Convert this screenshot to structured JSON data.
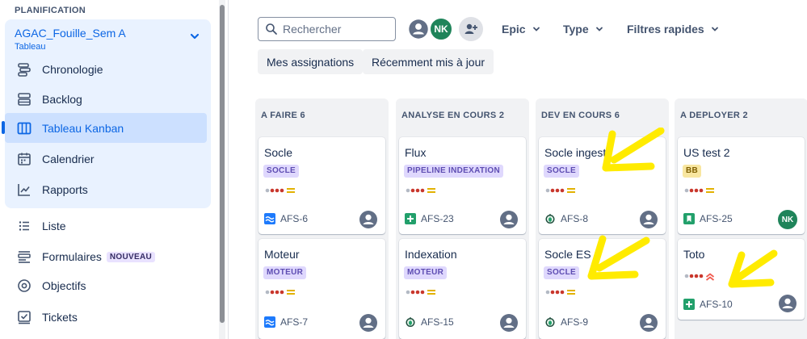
{
  "sidebar": {
    "section_title": "PLANIFICATION",
    "project": {
      "name": "AGAC_Fouille_Sem A",
      "subtitle": "Tableau"
    },
    "items": [
      {
        "label": "Chronologie",
        "icon": "timeline-icon"
      },
      {
        "label": "Backlog",
        "icon": "backlog-icon"
      },
      {
        "label": "Tableau Kanban",
        "icon": "board-icon",
        "active": true
      },
      {
        "label": "Calendrier",
        "icon": "calendar-icon"
      },
      {
        "label": "Rapports",
        "icon": "reports-icon"
      }
    ],
    "extra_items": [
      {
        "label": "Liste",
        "icon": "list-icon"
      },
      {
        "label": "Formulaires",
        "icon": "forms-icon",
        "badge": "NOUVEAU"
      },
      {
        "label": "Objectifs",
        "icon": "goals-icon"
      },
      {
        "label": "Tickets",
        "icon": "tickets-icon"
      }
    ]
  },
  "toolbar": {
    "search_placeholder": "Rechercher",
    "avatar_initials": "NK",
    "filters": [
      "Epic",
      "Type",
      "Filtres rapides"
    ],
    "quick_buttons": [
      "Mes assignations",
      "Récemment mis à jour"
    ]
  },
  "columns": [
    {
      "title": "A FAIRE 6",
      "cards": [
        {
          "title": "Socle",
          "tag": "SOCLE",
          "priority": "medium",
          "key": "AFS-6",
          "key_icon": "epic-wave-icon",
          "assignee": "unassigned"
        },
        {
          "title": "Moteur",
          "tag": "MOTEUR",
          "priority": "medium",
          "key": "AFS-7",
          "key_icon": "epic-wave-icon",
          "assignee": "unassigned"
        }
      ]
    },
    {
      "title": "ANALYSE EN COURS 2",
      "cards": [
        {
          "title": "Flux",
          "tag": "PIPELINE INDEXATION",
          "priority": "medium",
          "key": "AFS-23",
          "key_icon": "subtask-plus-icon",
          "assignee": "unassigned"
        },
        {
          "title": "Indexation",
          "tag": "MOTEUR",
          "priority": "medium",
          "key": "AFS-15",
          "key_icon": "bug-icon",
          "assignee": "unassigned"
        }
      ]
    },
    {
      "title": "DEV EN COURS 6",
      "cards": [
        {
          "title": "Socle ingest",
          "tag": "SOCLE",
          "priority": "medium",
          "key": "AFS-8",
          "key_icon": "bug-icon",
          "assignee": "unassigned"
        },
        {
          "title": "Socle ES",
          "tag": "SOCLE",
          "priority": "medium",
          "key": "AFS-9",
          "key_icon": "bug-icon",
          "assignee": "unassigned"
        }
      ]
    },
    {
      "title": "A DEPLOYER 2",
      "cards": [
        {
          "title": "US test 2",
          "tag": "BB",
          "tag_color": "yellow",
          "priority": "medium",
          "key": "AFS-25",
          "key_icon": "story-icon",
          "assignee": "NK"
        },
        {
          "title": "Toto",
          "tag": "",
          "priority": "high",
          "key": "AFS-10",
          "key_icon": "subtask-plus-icon",
          "assignee": "unassigned"
        }
      ]
    }
  ],
  "colors": {
    "accent": "#0c66e4",
    "active_bg": "#cce0ff",
    "panel_bg": "#e9f2ff",
    "column_bg": "#f1f2f4",
    "annotation": "#ffeb00"
  }
}
